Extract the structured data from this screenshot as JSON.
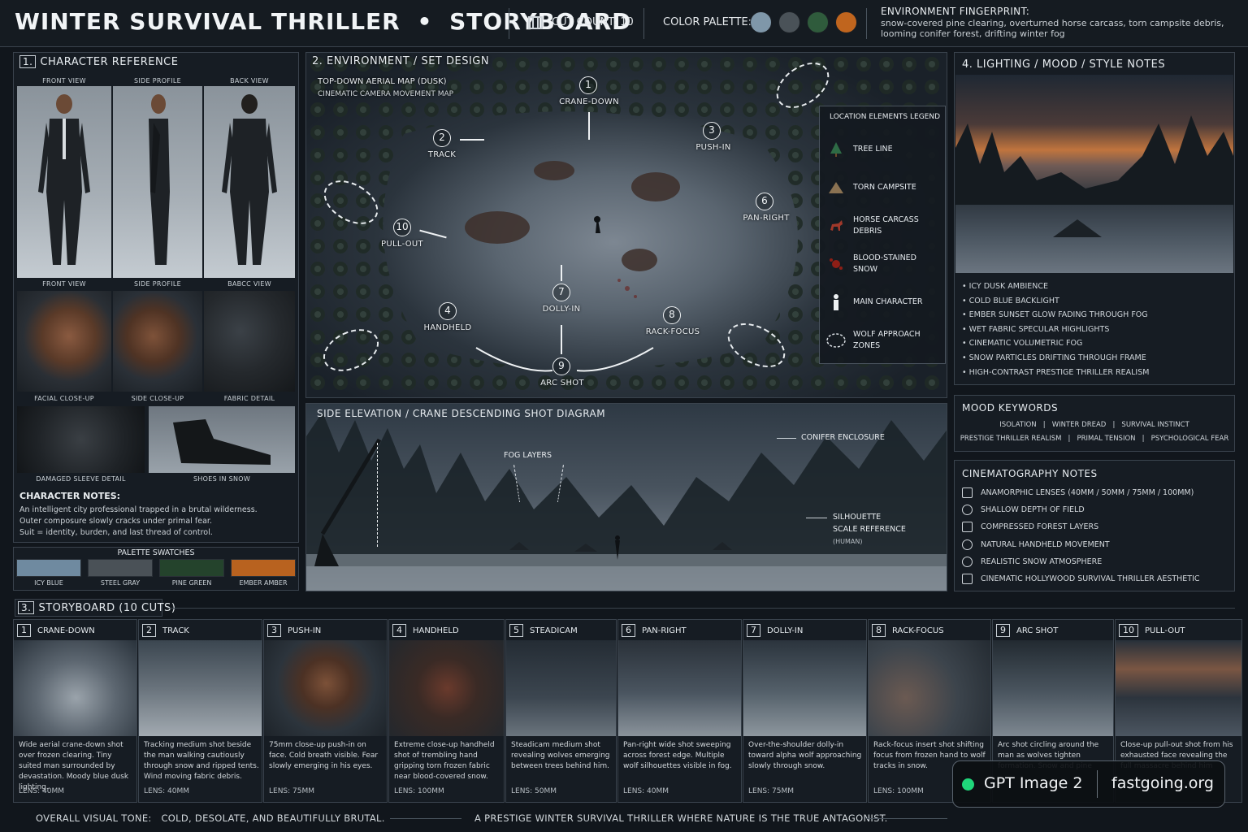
{
  "header": {
    "title": "WINTER SURVIVAL THRILLER",
    "bullet": "•",
    "subtitle": "STORYBOARD",
    "cut_count": "CUT COUNT: 10",
    "palette_label": "COLOR PALETTE:",
    "palette_colors": [
      "#7f97a9",
      "#4a5258",
      "#2f5b3c",
      "#c0651e"
    ],
    "env_title": "ENVIRONMENT FINGERPRINT:",
    "env_line1": "snow-covered pine clearing, overturned horse carcass, torn campsite debris,",
    "env_line2": "looming conifer forest, drifting winter fog"
  },
  "character": {
    "title_num": "1.",
    "title": "CHARACTER REFERENCE",
    "top_labels": [
      "FRONT VIEW",
      "SIDE PROFILE",
      "BACK VIEW"
    ],
    "bottom_labels": [
      "FRONT VIEW",
      "SIDE PROFILE",
      "BABCC VIEW"
    ],
    "closeups": [
      "FACIAL CLOSE-UP",
      "SIDE CLOSE-UP",
      "FABRIC DETAIL"
    ],
    "details": [
      "DAMAGED SLEEVE DETAIL",
      "SHOES IN SNOW"
    ],
    "notes_title": "CHARACTER NOTES:",
    "notes": [
      "An intelligent city professional trapped in a brutal wilderness.",
      "Outer composure slowly cracks under primal fear.",
      "Suit = identity, burden, and last thread of control."
    ],
    "swatch_title": "PALETTE SWATCHES",
    "swatches": [
      {
        "name": "ICY BLUE",
        "color": "#6f8aa0"
      },
      {
        "name": "STEEL GRAY",
        "color": "#4a5157"
      },
      {
        "name": "PINE GREEN",
        "color": "#24432c"
      },
      {
        "name": "EMBER AMBER",
        "color": "#b8621f"
      }
    ]
  },
  "environment": {
    "title_num": "2.",
    "title": "ENVIRONMENT / SET DESIGN",
    "sub1": "TOP-DOWN AERIAL MAP (DUSK)",
    "sub2": "CINEMATIC CAMERA MOVEMENT MAP",
    "moves": [
      {
        "n": "1",
        "label": "CRANE-DOWN"
      },
      {
        "n": "2",
        "label": "TRACK"
      },
      {
        "n": "3",
        "label": "PUSH-IN"
      },
      {
        "n": "4",
        "label": "HANDHELD"
      },
      {
        "n": "6",
        "label": "PAN-RIGHT"
      },
      {
        "n": "7",
        "label": "DOLLY-IN"
      },
      {
        "n": "8",
        "label": "RACK-FOCUS"
      },
      {
        "n": "9",
        "label": "ARC SHOT"
      },
      {
        "n": "10",
        "label": "PULL-OUT"
      }
    ],
    "legend_title": "LOCATION ELEMENTS LEGEND",
    "legend": [
      {
        "icon": "tree-icon",
        "label": "TREE LINE"
      },
      {
        "icon": "tent-icon",
        "label": "TORN CAMPSITE"
      },
      {
        "icon": "horse-icon",
        "label": "HORSE CARCASS DEBRIS"
      },
      {
        "icon": "blood-icon",
        "label": "BLOOD-STAINED SNOW"
      },
      {
        "icon": "person-icon",
        "label": "MAIN CHARACTER"
      },
      {
        "icon": "wolf-zone-icon",
        "label": "WOLF APPROACH ZONES"
      }
    ]
  },
  "elevation": {
    "title": "SIDE ELEVATION / CRANE DESCENDING SHOT DIAGRAM",
    "fog": "FOG LAYERS",
    "enclosure": "CONIFER ENCLOSURE",
    "silhouette1": "SILHOUETTE",
    "silhouette2": "SCALE REFERENCE",
    "silhouette3": "(HUMAN)"
  },
  "lighting": {
    "title_num": "4.",
    "title": "LIGHTING / MOOD / STYLE NOTES",
    "bullets": [
      "ICY DUSK AMBIENCE",
      "COLD BLUE BACKLIGHT",
      "EMBER SUNSET GLOW FADING THROUGH FOG",
      "WET FABRIC SPECULAR HIGHLIGHTS",
      "CINEMATIC VOLUMETRIC FOG",
      "SNOW PARTICLES DRIFTING THROUGH FRAME",
      "HIGH-CONTRAST PRESTIGE THRILLER REALISM"
    ],
    "mood_title": "MOOD KEYWORDS",
    "mood_line1": "ISOLATION   |   WINTER DREAD   |   SURVIVAL INSTINCT",
    "mood_line2": "PRESTIGE THRILLER REALISM   |   PRIMAL TENSION   |   PSYCHOLOGICAL FEAR",
    "cine_title": "CINEMATOGRAPHY NOTES",
    "cine": [
      {
        "icon": "camera-icon",
        "label": "ANAMORPHIC LENSES (40MM / 50MM / 75MM / 100MM)"
      },
      {
        "icon": "aperture-icon",
        "label": "SHALLOW DEPTH OF FIELD"
      },
      {
        "icon": "layers-icon",
        "label": "COMPRESSED FOREST LAYERS"
      },
      {
        "icon": "handheld-icon",
        "label": "NATURAL HANDHELD MOVEMENT"
      },
      {
        "icon": "snow-icon",
        "label": "REALISTIC SNOW ATMOSPHERE"
      },
      {
        "icon": "frame-icon",
        "label": "CINEMATIC HOLLYWOOD SURVIVAL THRILLER AESTHETIC"
      }
    ]
  },
  "storyboard": {
    "title_num": "3.",
    "title": "STORYBOARD (10 CUTS)",
    "cuts": [
      {
        "n": "1",
        "name": "CRANE-DOWN",
        "text": "Wide aerial crane-down shot over frozen clearing. Tiny suited man surrounded by devastation. Moody blue dusk lighting.",
        "lens": "LENS: 40MM"
      },
      {
        "n": "2",
        "name": "TRACK",
        "text": "Tracking medium shot beside the man walking cautiously through snow and ripped tents. Wind moving fabric debris.",
        "lens": "LENS: 40MM"
      },
      {
        "n": "3",
        "name": "PUSH-IN",
        "text": "75mm close-up push-in on face. Cold breath visible. Fear slowly emerging in his eyes.",
        "lens": "LENS: 75MM"
      },
      {
        "n": "4",
        "name": "HANDHELD",
        "text": "Extreme close-up handheld shot of trembling hand gripping torn frozen fabric near blood-covered snow.",
        "lens": "LENS: 100MM"
      },
      {
        "n": "5",
        "name": "STEADICAM",
        "text": "Steadicam medium shot revealing wolves emerging between trees behind him.",
        "lens": "LENS: 50MM"
      },
      {
        "n": "6",
        "name": "PAN-RIGHT",
        "text": "Pan-right wide shot sweeping across forest edge. Multiple wolf silhouettes visible in fog.",
        "lens": "LENS: 40MM"
      },
      {
        "n": "7",
        "name": "DOLLY-IN",
        "text": "Over-the-shoulder dolly-in toward alpha wolf approaching slowly through snow.",
        "lens": "LENS: 75MM"
      },
      {
        "n": "8",
        "name": "RACK-FOCUS",
        "text": "Rack-focus insert shot shifting focus from frozen hand to wolf tracks in snow.",
        "lens": "LENS: 100MM"
      },
      {
        "n": "9",
        "name": "ARC SHOT",
        "text": "Arc shot circling around the man as wolves tighten formation. Snow and pine",
        "lens": ""
      },
      {
        "n": "10",
        "name": "PULL-OUT",
        "text": "Close-up pull-out shot from his exhausted face revealing the full massacre behind him",
        "lens": ""
      }
    ]
  },
  "footer": {
    "tone_label": "OVERALL VISUAL TONE:",
    "tone": "COLD, DESOLATE, AND BEAUTIFULLY BRUTAL.",
    "tagline": "A PRESTIGE WINTER SURVIVAL THRILLER WHERE NATURE IS THE TRUE ANTAGONIST."
  },
  "badge": {
    "product": "GPT Image 2",
    "site": "fastgoing.org"
  }
}
